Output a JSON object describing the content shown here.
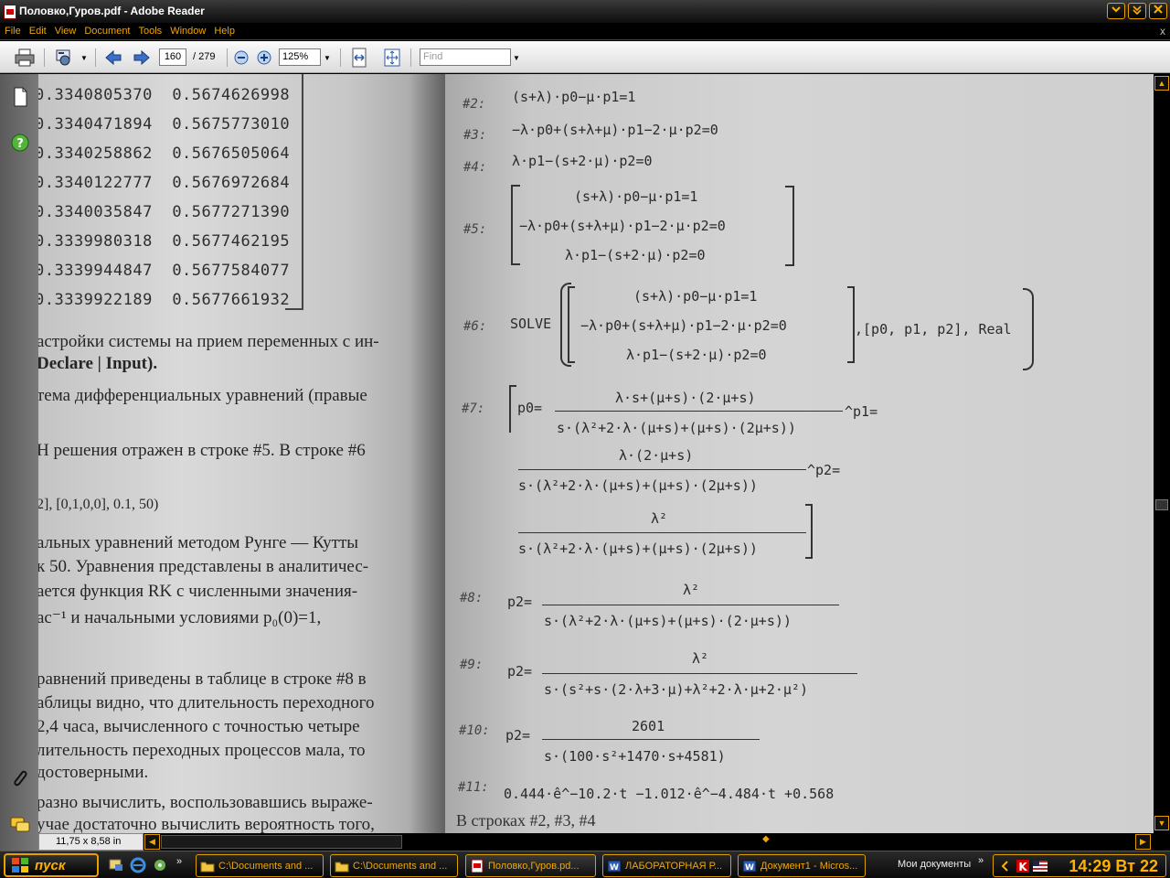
{
  "window": {
    "title": "Половко,Гуров.pdf - Adobe Reader",
    "colors": {
      "accent": "#f0a800",
      "chrome": "#000000"
    }
  },
  "menu": {
    "items": [
      "File",
      "Edit",
      "View",
      "Document",
      "Tools",
      "Window",
      "Help"
    ],
    "close": "x"
  },
  "toolbar": {
    "page_current": "160",
    "page_total": "/ 279",
    "zoom": "125%",
    "find_placeholder": "Find"
  },
  "status": {
    "page_size": "11,75 x 8,58 in"
  },
  "left_page": {
    "table_rows": [
      [
        "0.3340805370",
        "0.5674626998"
      ],
      [
        "0.3340471894",
        "0.5675773010"
      ],
      [
        "0.3340258862",
        "0.5676505064"
      ],
      [
        "0.3340122777",
        "0.5676972684"
      ],
      [
        "0.3340035847",
        "0.5677271390"
      ],
      [
        "0.3339980318",
        "0.5677462195"
      ],
      [
        "0.3339944847",
        "0.5677584077"
      ],
      [
        "0.3339922189",
        "0.5677661932"
      ]
    ],
    "text_lines": [
      "астройки системы на прием переменных с ин-",
      "Declare | Input).",
      "тема  дифференциальных  уравнений  (правые",
      "Н решения отражен в строке #5. В строке #6",
      "2],  [0,1,0,0],  0.1,  50)",
      "альных  уравнений  методом  Рунге — Кутты",
      "к 50. Уравнения представлены в аналитичес-",
      "ается  функция  RK  с  численными  значения-",
      "ас⁻¹    и    начальными    условиями     p₀(0)=1,",
      "равнений приведены в таблице в строке #8 в",
      "аблицы видно, что длительность переходного",
      " 2,4 часа, вычисленного с точностью четыре",
      "лительность переходных процессов мала, то",
      "достоверными.",
      "разно вычислить, воспользовавшись выраже-",
      "учае достаточно вычислить вероятность того,"
    ]
  },
  "right_page": {
    "labels": [
      "#2:",
      "#3:",
      "#4:",
      "#5:",
      "#6:",
      "#7:",
      "#8:",
      "#9:",
      "#10:",
      "#11:"
    ],
    "eq2": "(s+λ)·p0−μ·p1=1",
    "eq3": "−λ·p0+(s+λ+μ)·p1−2·μ·p2=0",
    "eq4": "λ·p1−(s+2·μ)·p2=0",
    "eq5": [
      "(s+λ)·p0−μ·p1=1",
      "−λ·p0+(s+λ+μ)·p1−2·μ·p2=0",
      "λ·p1−(s+2·μ)·p2=0"
    ],
    "eq6": {
      "cmd": "SOLVE",
      "rows": [
        "(s+λ)·p0−μ·p1=1",
        "−λ·p0+(s+λ+μ)·p1−2·μ·p2=0",
        "λ·p1−(s+2·μ)·p2=0"
      ],
      "tail": ",[p0, p1, p2], Real"
    },
    "eq7": {
      "p0_lhs": "p0=",
      "p0_num": "λ·s+(μ+s)·(2·μ+s)",
      "p0_den": "s·(λ²+2·λ·(μ+s)+(μ+s)·(2μ+s))",
      "p1_lhs": "^p1=",
      "p1_num": "λ·(2·μ+s)",
      "p1_den": "s·(λ²+2·λ·(μ+s)+(μ+s)·(2μ+s))",
      "p2_lhs": "^p2=",
      "p2_num": "λ²",
      "p2_den": "s·(λ²+2·λ·(μ+s)+(μ+s)·(2μ+s))"
    },
    "eq8": {
      "lhs": "p2=",
      "num": "λ²",
      "den": "s·(λ²+2·λ·(μ+s)+(μ+s)·(2·μ+s))"
    },
    "eq9": {
      "lhs": "p2=",
      "num": "λ²",
      "den": "s·(s²+s·(2·λ+3·μ)+λ²+2·λ·μ+2·μ²)"
    },
    "eq10": {
      "lhs": "p2=",
      "num": "2601",
      "den": "s·(100·s²+1470·s+4581)"
    },
    "eq11": "0.444·ê^−10.2·t −1.012·ê^−4.484·t +0.568",
    "bottom_text": "В строках #2, #3, #4"
  },
  "taskbar": {
    "start": "пуск",
    "buttons": [
      {
        "label": "C:\\Documents and ...",
        "icon": "folder-icon"
      },
      {
        "label": "C:\\Documents and ...",
        "icon": "folder-icon"
      },
      {
        "label": "Половко,Гуров.pd...",
        "icon": "pdf-icon"
      },
      {
        "label": "ЛАБОРАТОРНАЯ Р...",
        "icon": "word-icon"
      },
      {
        "label": "Документ1 - Micros...",
        "icon": "word-icon"
      }
    ],
    "my_docs": "Мои документы",
    "clock": "14:29 Вт 22"
  }
}
